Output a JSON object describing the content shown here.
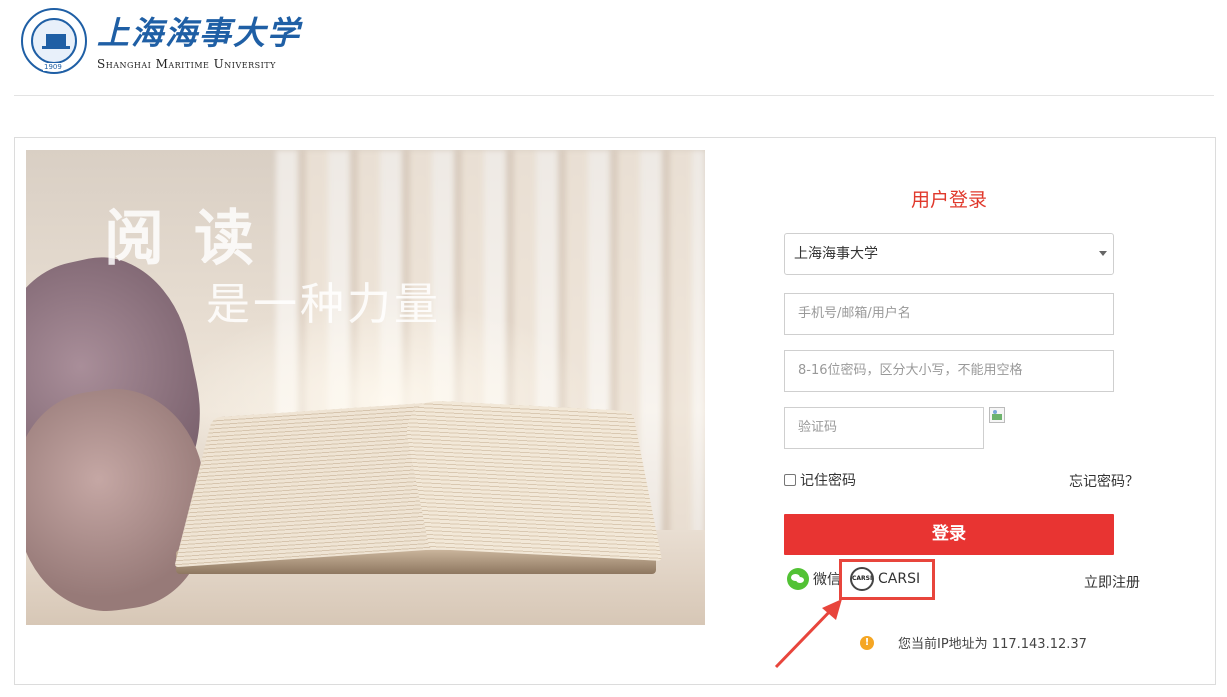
{
  "header": {
    "logo_icon": "university-seal-icon",
    "seal_year": "1909",
    "school_name_cn": "上海海事大学",
    "school_name_en": "Shanghai Maritime University"
  },
  "hero": {
    "headline": "阅读",
    "subline": "是一种力量"
  },
  "login": {
    "title": "用户登录",
    "institution_select": "上海海事大学",
    "username_placeholder": "手机号/邮箱/用户名",
    "password_placeholder": "8-16位密码，区分大小写，不能用空格",
    "captcha_placeholder": "验证码",
    "remember_label": "记住密码",
    "remember_checked": false,
    "forgot_label": "忘记密码？",
    "submit_label": "登录",
    "wechat_label": "微信",
    "carsi_label": "CARSI",
    "carsi_icon_text": "CARSI",
    "register_label": "立即注册",
    "ip_notice": "您当前IP地址为 117.143.12.37"
  },
  "colors": {
    "brand_blue": "#1f5fa5",
    "title_red": "#e0392c",
    "button_red": "#e83432",
    "highlight_red": "#e8453c",
    "wechat_green": "#52c234",
    "warning_orange": "#f5a623"
  }
}
